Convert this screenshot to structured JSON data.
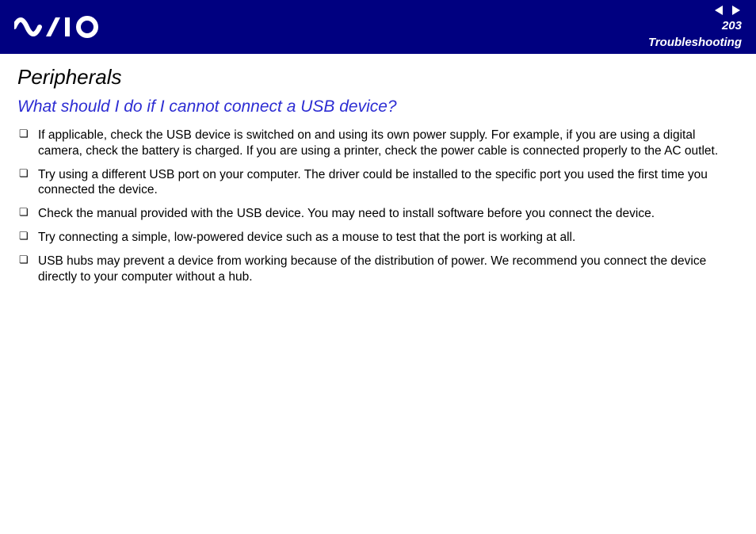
{
  "header": {
    "page_number": "203",
    "section": "Troubleshooting"
  },
  "content": {
    "title": "Peripherals",
    "question": "What should I do if I cannot connect a USB device?",
    "bullets": [
      "If applicable, check the USB device is switched on and using its own power supply. For example, if you are using a digital camera, check the battery is charged. If you are using a printer, check the power cable is connected properly to the AC outlet.",
      "Try using a different USB port on your computer. The driver could be installed to the specific port you used the first time you connected the device.",
      "Check the manual provided with the USB device. You may need to install software before you connect the device.",
      "Try connecting a simple, low-powered device such as a mouse to test that the port is working at all.",
      "USB hubs may prevent a device from working because of the distribution of power. We recommend you connect the device directly to your computer without a hub."
    ]
  }
}
